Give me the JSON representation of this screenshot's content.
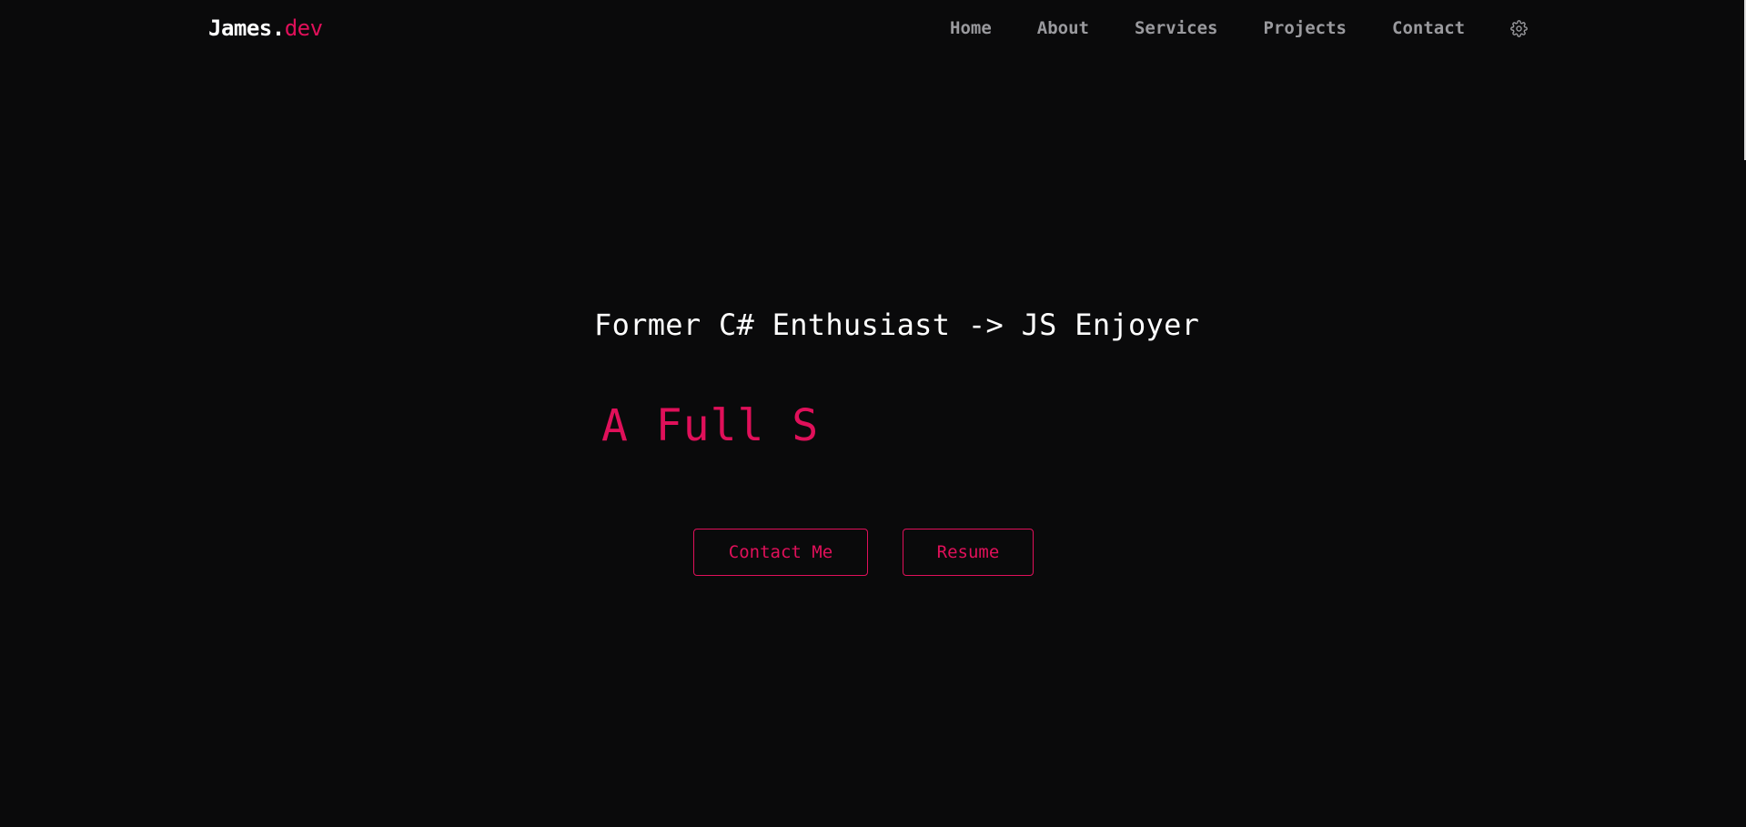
{
  "header": {
    "logo": {
      "name": "James.",
      "accent": "dev"
    },
    "nav": [
      {
        "label": "Home"
      },
      {
        "label": "About"
      },
      {
        "label": "Services"
      },
      {
        "label": "Projects"
      },
      {
        "label": "Contact"
      }
    ],
    "theme_icon": "gear-icon"
  },
  "hero": {
    "subtitle": "Former C# Enthusiast -> JS Enjoyer",
    "title": "A Full S",
    "buttons": {
      "contact": "Contact Me",
      "resume": "Resume"
    }
  },
  "colors": {
    "background": "#0a0a0b",
    "accent": "#e0105a",
    "nav_text": "#9a9a9e",
    "text": "#ffffff"
  }
}
